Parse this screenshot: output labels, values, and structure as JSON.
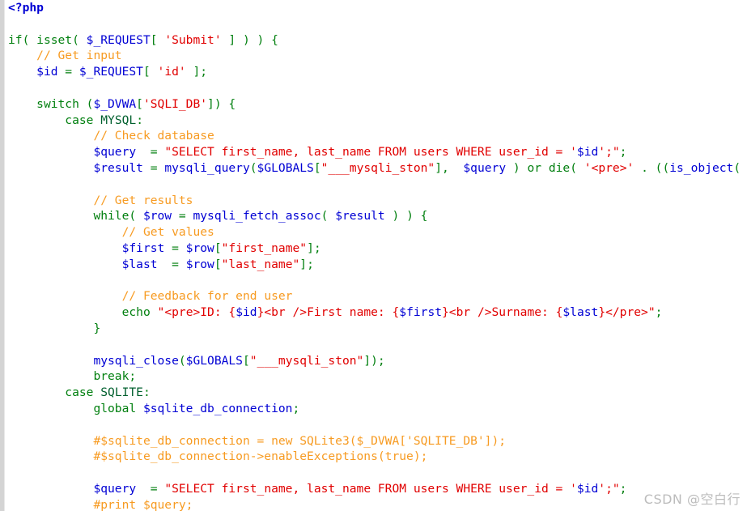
{
  "document": {
    "kind": "php-source-listing",
    "background_color": "#ffffff",
    "gutter_color": "#d4d4d4",
    "syntax_colors": {
      "keyword": "#007f0e",
      "variable": "#0000d4",
      "string": "#e10000",
      "comment": "#f79b22",
      "constant": "#005f2e",
      "plain": "#000000"
    }
  },
  "watermark": {
    "text": "CSDN @空白行"
  },
  "code": {
    "language": "PHP",
    "lines": [
      [
        {
          "t": "<?php",
          "c": "tag"
        }
      ],
      [],
      [
        {
          "t": "if",
          "c": "kw"
        },
        {
          "t": "( ",
          "c": "kw"
        },
        {
          "t": "isset",
          "c": "kw"
        },
        {
          "t": "( ",
          "c": "kw"
        },
        {
          "t": "$_REQUEST",
          "c": "var"
        },
        {
          "t": "[ ",
          "c": "kw"
        },
        {
          "t": "'Submit'",
          "c": "str"
        },
        {
          "t": " ] ) ) {",
          "c": "kw"
        }
      ],
      [
        {
          "t": "    ",
          "c": "def"
        },
        {
          "t": "// Get input",
          "c": "com"
        }
      ],
      [
        {
          "t": "    ",
          "c": "def"
        },
        {
          "t": "$id",
          "c": "var"
        },
        {
          "t": " = ",
          "c": "kw"
        },
        {
          "t": "$_REQUEST",
          "c": "var"
        },
        {
          "t": "[ ",
          "c": "kw"
        },
        {
          "t": "'id'",
          "c": "str"
        },
        {
          "t": " ];",
          "c": "kw"
        }
      ],
      [],
      [
        {
          "t": "    ",
          "c": "def"
        },
        {
          "t": "switch",
          "c": "kw"
        },
        {
          "t": " (",
          "c": "kw"
        },
        {
          "t": "$_DVWA",
          "c": "var"
        },
        {
          "t": "[",
          "c": "kw"
        },
        {
          "t": "'SQLI_DB'",
          "c": "str"
        },
        {
          "t": "]) {",
          "c": "kw"
        }
      ],
      [
        {
          "t": "        ",
          "c": "def"
        },
        {
          "t": "case",
          "c": "kw"
        },
        {
          "t": " ",
          "c": "def"
        },
        {
          "t": "MYSQL",
          "c": "const"
        },
        {
          "t": ":",
          "c": "kw"
        }
      ],
      [
        {
          "t": "            ",
          "c": "def"
        },
        {
          "t": "// Check database",
          "c": "com"
        }
      ],
      [
        {
          "t": "            ",
          "c": "def"
        },
        {
          "t": "$query",
          "c": "var"
        },
        {
          "t": "  = ",
          "c": "kw"
        },
        {
          "t": "\"SELECT first_name, last_name FROM users WHERE user_id = '",
          "c": "str"
        },
        {
          "t": "$id",
          "c": "var"
        },
        {
          "t": "';\"",
          "c": "str"
        },
        {
          "t": ";",
          "c": "kw"
        }
      ],
      [
        {
          "t": "            ",
          "c": "def"
        },
        {
          "t": "$result",
          "c": "var"
        },
        {
          "t": " = ",
          "c": "kw"
        },
        {
          "t": "mysqli_query",
          "c": "var"
        },
        {
          "t": "(",
          "c": "kw"
        },
        {
          "t": "$GLOBALS",
          "c": "var"
        },
        {
          "t": "[",
          "c": "kw"
        },
        {
          "t": "\"___mysqli_ston\"",
          "c": "str"
        },
        {
          "t": "],  ",
          "c": "kw"
        },
        {
          "t": "$query",
          "c": "var"
        },
        {
          "t": " ) ",
          "c": "kw"
        },
        {
          "t": "or",
          "c": "kw"
        },
        {
          "t": " ",
          "c": "def"
        },
        {
          "t": "die",
          "c": "kw"
        },
        {
          "t": "( ",
          "c": "kw"
        },
        {
          "t": "'<pre>'",
          "c": "str"
        },
        {
          "t": " . ((",
          "c": "kw"
        },
        {
          "t": "is_object",
          "c": "var"
        },
        {
          "t": "(",
          "c": "kw"
        }
      ],
      [],
      [
        {
          "t": "            ",
          "c": "def"
        },
        {
          "t": "// Get results",
          "c": "com"
        }
      ],
      [
        {
          "t": "            ",
          "c": "def"
        },
        {
          "t": "while",
          "c": "kw"
        },
        {
          "t": "( ",
          "c": "kw"
        },
        {
          "t": "$row",
          "c": "var"
        },
        {
          "t": " = ",
          "c": "kw"
        },
        {
          "t": "mysqli_fetch_assoc",
          "c": "var"
        },
        {
          "t": "( ",
          "c": "kw"
        },
        {
          "t": "$result",
          "c": "var"
        },
        {
          "t": " ) ) {",
          "c": "kw"
        }
      ],
      [
        {
          "t": "                ",
          "c": "def"
        },
        {
          "t": "// Get values",
          "c": "com"
        }
      ],
      [
        {
          "t": "                ",
          "c": "def"
        },
        {
          "t": "$first",
          "c": "var"
        },
        {
          "t": " = ",
          "c": "kw"
        },
        {
          "t": "$row",
          "c": "var"
        },
        {
          "t": "[",
          "c": "kw"
        },
        {
          "t": "\"first_name\"",
          "c": "str"
        },
        {
          "t": "];",
          "c": "kw"
        }
      ],
      [
        {
          "t": "                ",
          "c": "def"
        },
        {
          "t": "$last",
          "c": "var"
        },
        {
          "t": "  = ",
          "c": "kw"
        },
        {
          "t": "$row",
          "c": "var"
        },
        {
          "t": "[",
          "c": "kw"
        },
        {
          "t": "\"last_name\"",
          "c": "str"
        },
        {
          "t": "];",
          "c": "kw"
        }
      ],
      [],
      [
        {
          "t": "                ",
          "c": "def"
        },
        {
          "t": "// Feedback for end user",
          "c": "com"
        }
      ],
      [
        {
          "t": "                ",
          "c": "def"
        },
        {
          "t": "echo",
          "c": "kw"
        },
        {
          "t": " ",
          "c": "def"
        },
        {
          "t": "\"<pre>ID: {",
          "c": "str"
        },
        {
          "t": "$id",
          "c": "var"
        },
        {
          "t": "}<br />First name: {",
          "c": "str"
        },
        {
          "t": "$first",
          "c": "var"
        },
        {
          "t": "}<br />Surname: {",
          "c": "str"
        },
        {
          "t": "$last",
          "c": "var"
        },
        {
          "t": "}</pre>\"",
          "c": "str"
        },
        {
          "t": ";",
          "c": "kw"
        }
      ],
      [
        {
          "t": "            ",
          "c": "def"
        },
        {
          "t": "}",
          "c": "kw"
        }
      ],
      [],
      [
        {
          "t": "            ",
          "c": "def"
        },
        {
          "t": "mysqli_close",
          "c": "var"
        },
        {
          "t": "(",
          "c": "kw"
        },
        {
          "t": "$GLOBALS",
          "c": "var"
        },
        {
          "t": "[",
          "c": "kw"
        },
        {
          "t": "\"___mysqli_ston\"",
          "c": "str"
        },
        {
          "t": "]);",
          "c": "kw"
        }
      ],
      [
        {
          "t": "            ",
          "c": "def"
        },
        {
          "t": "break",
          "c": "kw"
        },
        {
          "t": ";",
          "c": "kw"
        }
      ],
      [
        {
          "t": "        ",
          "c": "def"
        },
        {
          "t": "case",
          "c": "kw"
        },
        {
          "t": " ",
          "c": "def"
        },
        {
          "t": "SQLITE",
          "c": "const"
        },
        {
          "t": ":",
          "c": "kw"
        }
      ],
      [
        {
          "t": "            ",
          "c": "def"
        },
        {
          "t": "global",
          "c": "kw"
        },
        {
          "t": " ",
          "c": "def"
        },
        {
          "t": "$sqlite_db_connection",
          "c": "var"
        },
        {
          "t": ";",
          "c": "kw"
        }
      ],
      [],
      [
        {
          "t": "            ",
          "c": "def"
        },
        {
          "t": "#$sqlite_db_connection = new SQLite3($_DVWA['SQLITE_DB']);",
          "c": "com"
        }
      ],
      [
        {
          "t": "            ",
          "c": "def"
        },
        {
          "t": "#$sqlite_db_connection->enableExceptions(true);",
          "c": "com"
        }
      ],
      [],
      [
        {
          "t": "            ",
          "c": "def"
        },
        {
          "t": "$query",
          "c": "var"
        },
        {
          "t": "  = ",
          "c": "kw"
        },
        {
          "t": "\"SELECT first_name, last_name FROM users WHERE user_id = '",
          "c": "str"
        },
        {
          "t": "$id",
          "c": "var"
        },
        {
          "t": "';\"",
          "c": "str"
        },
        {
          "t": ";",
          "c": "kw"
        }
      ],
      [
        {
          "t": "            ",
          "c": "def"
        },
        {
          "t": "#print $query;",
          "c": "com"
        }
      ]
    ]
  }
}
